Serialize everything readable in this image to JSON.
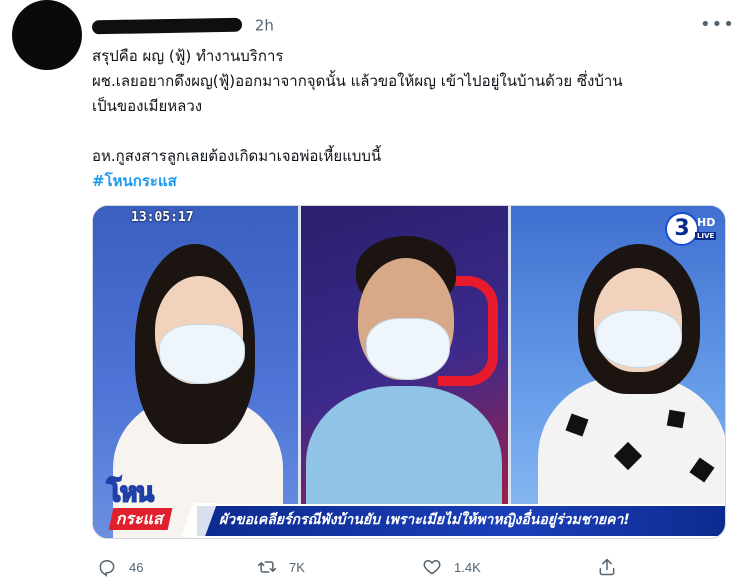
{
  "tweet": {
    "time": "2h",
    "text_lines": [
      "สรุปคือ ผญ (ฟู้) ทำงานบริการ",
      "ผช.เลยอยากดึงผญ(ฟู้)ออกมาจากจุดนั้น แล้วขอให้ผญ เข้าไปอยู่ในบ้านด้วย ซึ่งบ้าน",
      "เป็นของเมียหลวง",
      "อห.กูสงสารลูกเลยต้องเกิดมาเจอพ่อเหี้ยแบบนี้"
    ],
    "hashtag": "#โหนกระแส",
    "more_icon": "ellipsis-icon"
  },
  "media": {
    "timestamp": "13:05:17",
    "channel_number": "3",
    "channel_hd": "HD",
    "channel_live": "LIVE",
    "show_logo_top": "โหน",
    "show_logo_bottom": "กระแส",
    "ticker_text": "ผัวขอเคลียร์กรณีพังบ้านยับ เพราะเมียไม่ให้พาหญิงอื่นอยู่ร่วมชายคา!"
  },
  "actions": {
    "reply": {
      "icon": "reply-icon",
      "count": "46"
    },
    "retweet": {
      "icon": "retweet-icon",
      "count": "7K"
    },
    "like": {
      "icon": "heart-icon",
      "count": "1.4K"
    },
    "share": {
      "icon": "share-icon"
    }
  },
  "colors": {
    "text": "#0f1419",
    "muted": "#536471",
    "link": "#1d9bf0",
    "border": "#cfd9de"
  }
}
